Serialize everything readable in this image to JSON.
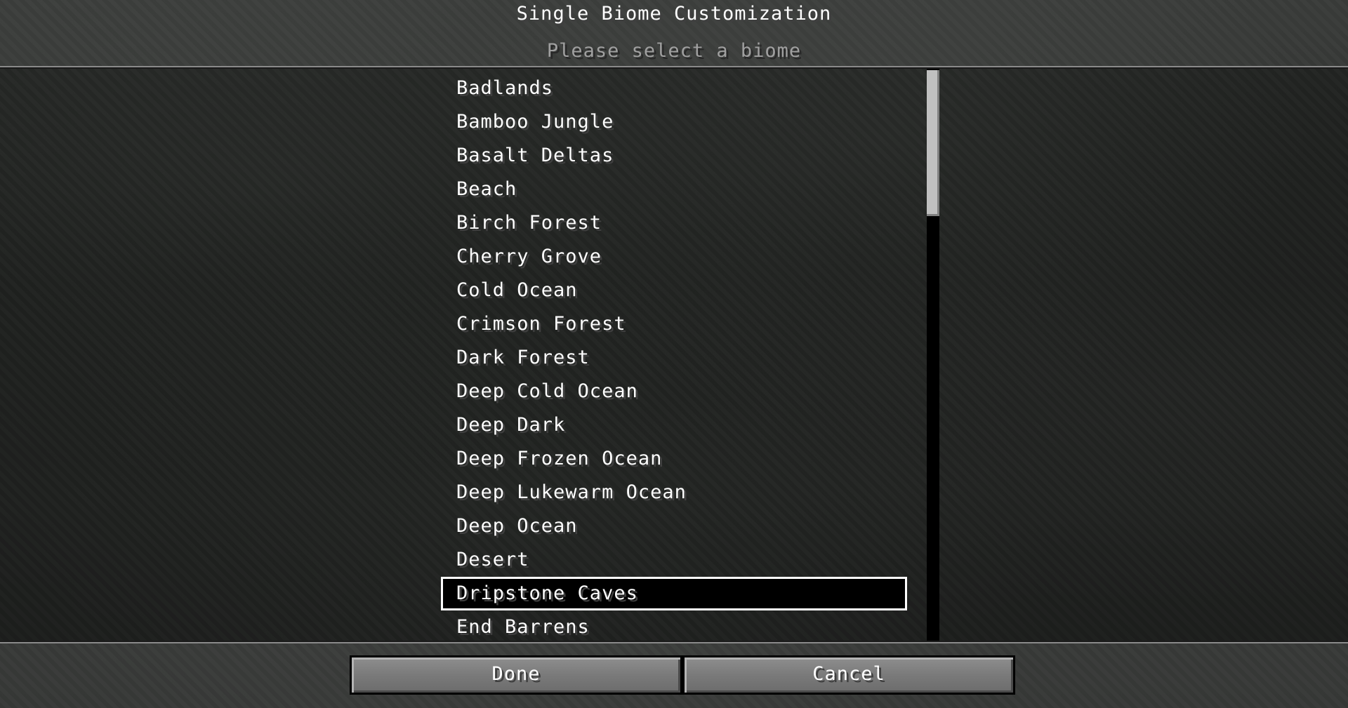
{
  "header": {
    "title": "Single Biome Customization",
    "subtitle": "Please select a biome"
  },
  "biome_list": {
    "items": [
      "Badlands",
      "Bamboo Jungle",
      "Basalt Deltas",
      "Beach",
      "Birch Forest",
      "Cherry Grove",
      "Cold Ocean",
      "Crimson Forest",
      "Dark Forest",
      "Deep Cold Ocean",
      "Deep Dark",
      "Deep Frozen Ocean",
      "Deep Lukewarm Ocean",
      "Deep Ocean",
      "Desert",
      "Dripstone Caves",
      "End Barrens"
    ],
    "selected": "Dripstone Caves"
  },
  "footer": {
    "done_label": "Done",
    "cancel_label": "Cancel"
  }
}
